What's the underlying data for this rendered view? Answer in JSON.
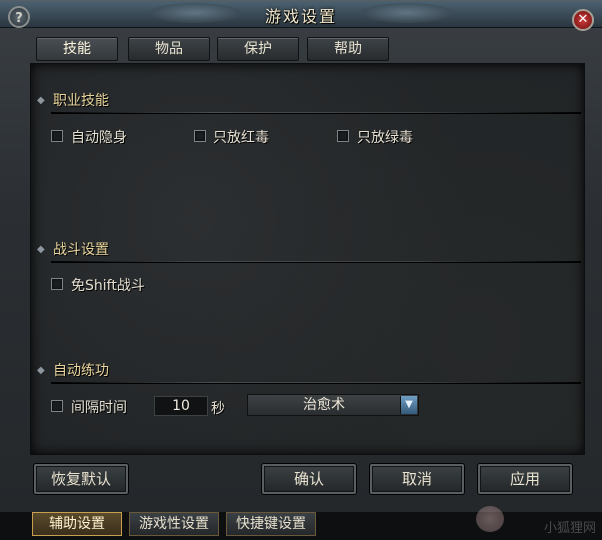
{
  "window": {
    "title": "游戏设置"
  },
  "tabs": [
    {
      "label": "技能"
    },
    {
      "label": "物品"
    },
    {
      "label": "保护"
    },
    {
      "label": "帮助"
    }
  ],
  "sections": {
    "skills": {
      "title": "职业技能",
      "options": [
        {
          "label": "自动隐身",
          "checked": false
        },
        {
          "label": "只放红毒",
          "checked": false
        },
        {
          "label": "只放绿毒",
          "checked": false
        }
      ]
    },
    "combat": {
      "title": "战斗设置",
      "options": [
        {
          "label": "免Shift战斗",
          "checked": false
        }
      ]
    },
    "autotrain": {
      "title": "自动练功",
      "interval_label": "间隔时间",
      "interval_checked": false,
      "interval_value": "10",
      "interval_unit": "秒",
      "skill_select": "治愈术"
    }
  },
  "buttons": {
    "restore_default": "恢复默认",
    "confirm": "确认",
    "cancel": "取消",
    "apply": "应用"
  },
  "bottom_tabs": [
    {
      "label": "辅助设置",
      "active": true
    },
    {
      "label": "游戏性设置",
      "active": false
    },
    {
      "label": "快捷键设置",
      "active": false
    }
  ],
  "watermark": "小狐狸网",
  "colors": {
    "section_title": "#e9d59c",
    "accent_blue": "#4f7fa6"
  }
}
